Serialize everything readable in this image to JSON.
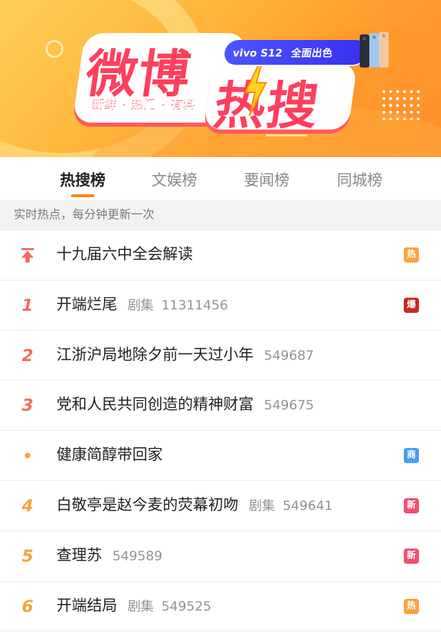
{
  "banner": {
    "logo_part1": "微博",
    "logo_part2": "热搜",
    "slogan": "新鲜 · 热门 · 有料",
    "ad_brand": "vivo S12",
    "ad_tagline": "全面出色",
    "colors": {
      "logo": "#ff3f5e",
      "ad_pill": "#4b56ff",
      "accent": "#ff8200"
    }
  },
  "tabs": [
    {
      "label": "热搜榜",
      "active": true
    },
    {
      "label": "文娱榜",
      "active": false
    },
    {
      "label": "要闻榜",
      "active": false
    },
    {
      "label": "同城榜",
      "active": false
    }
  ],
  "subheader": "实时热点，每分钟更新一次",
  "list": [
    {
      "rank": "",
      "rank_icon": "pin-top-icon",
      "title": "十九届六中全会解读",
      "category": "",
      "count": "",
      "badge": "热",
      "badge_color": "#f6a43d"
    },
    {
      "rank": "1",
      "title": "开端烂尾",
      "category": "剧集",
      "count": "11311456",
      "badge": "爆",
      "badge_color": "#c42a1f"
    },
    {
      "rank": "2",
      "title": "江浙沪局地除夕前一天过小年",
      "category": "",
      "count": "549687",
      "badge": "",
      "badge_color": ""
    },
    {
      "rank": "3",
      "title": "党和人民共同创造的精神财富",
      "category": "",
      "count": "549675",
      "badge": "",
      "badge_color": ""
    },
    {
      "rank": "",
      "rank_icon": "dot-icon",
      "title": "健康简醇带回家",
      "category": "",
      "count": "",
      "badge": "商",
      "badge_color": "#4a9cf0"
    },
    {
      "rank": "4",
      "title": "白敬亭是赵今麦的荧幕初吻",
      "category": "剧集",
      "count": "549641",
      "badge": "新",
      "badge_color": "#f0506e"
    },
    {
      "rank": "5",
      "title": "查理苏",
      "category": "",
      "count": "549589",
      "badge": "新",
      "badge_color": "#f0506e"
    },
    {
      "rank": "6",
      "title": "开端结局",
      "category": "剧集",
      "count": "549525",
      "badge": "热",
      "badge_color": "#f6a43d"
    }
  ]
}
